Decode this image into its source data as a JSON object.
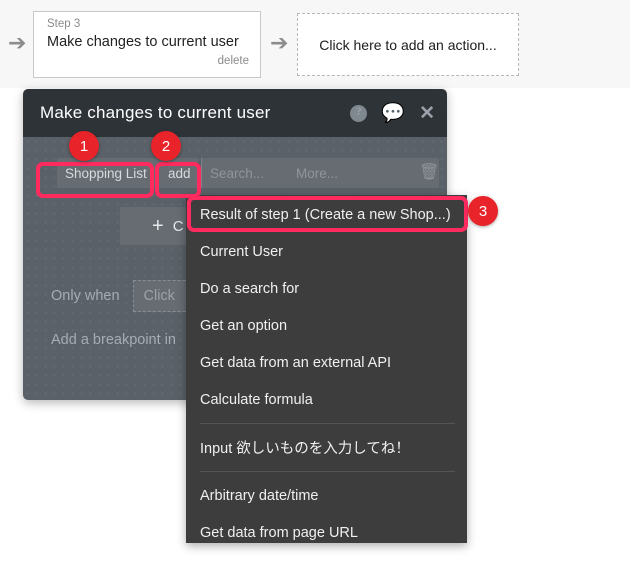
{
  "workflow": {
    "arrow_icon": "arrow-right",
    "step_card": {
      "step_label": "Step 3",
      "title": "Make changes to current user",
      "delete_label": "delete"
    },
    "add_action_card": {
      "label": "Click here to add an action..."
    }
  },
  "modal": {
    "title": "Make changes to current user",
    "icons": {
      "help": "?",
      "chat": "◯",
      "close": "✕"
    },
    "field_row": {
      "thing": "Shopping List",
      "operation": "add",
      "search_placeholder": "Search...",
      "more_label": "More...",
      "value": "",
      "trash_icon": "🗑"
    },
    "change_button": {
      "plus": "+",
      "label": "C"
    },
    "only_when": {
      "label": "Only when",
      "value": "Click"
    },
    "breakpoint": {
      "label": "Add a breakpoint in"
    }
  },
  "dropdown": {
    "groups": [
      {
        "items": [
          {
            "label": "Result of step 1 (Create a new Shop...)",
            "highlighted": true
          },
          {
            "label": "Current User",
            "highlighted": false
          },
          {
            "label": "Do a search for",
            "highlighted": false
          },
          {
            "label": "Get an option",
            "highlighted": false
          },
          {
            "label": "Get data from an external API",
            "highlighted": false
          },
          {
            "label": "Calculate formula",
            "highlighted": false
          }
        ]
      },
      {
        "items": [
          {
            "label": "Input 欲しいものを入力してね！",
            "highlighted": false
          }
        ]
      },
      {
        "items": [
          {
            "label": "Arbitrary date/time",
            "highlighted": false
          },
          {
            "label": "Get data from page URL",
            "highlighted": false
          }
        ]
      }
    ]
  },
  "annotations": {
    "badges": [
      {
        "number": "1"
      },
      {
        "number": "2"
      },
      {
        "number": "3"
      }
    ],
    "highlight_color": "#ff2b5e",
    "badge_color": "#e8232a"
  }
}
